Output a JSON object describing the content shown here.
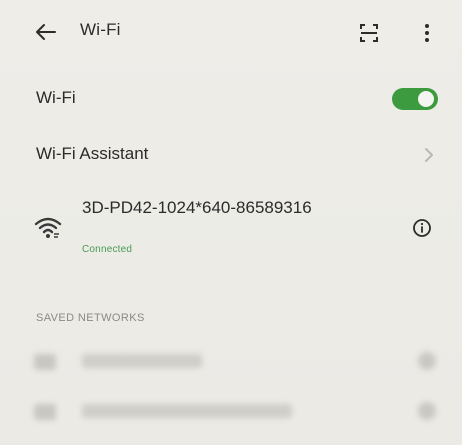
{
  "header": {
    "title": "Wi-Fi",
    "back_icon": "arrow-left-icon",
    "scan_icon": "qr-scan-icon",
    "more_icon": "more-vertical-icon"
  },
  "wifi_toggle": {
    "label": "Wi-Fi",
    "state": "on",
    "color": "#3d9b3f"
  },
  "assistant": {
    "label": "Wi-Fi Assistant"
  },
  "current_network": {
    "name": "3D-PD42-1024*640-86589316",
    "status": "Connected",
    "status_color": "#4a9a52"
  },
  "saved_networks": {
    "header": "SAVED NETWORKS"
  }
}
